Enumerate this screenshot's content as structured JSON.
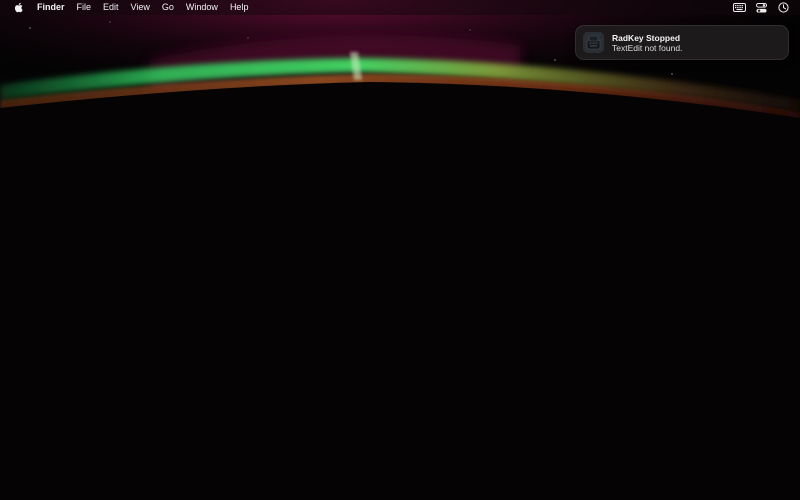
{
  "menubar": {
    "apple_icon": "apple-logo-icon",
    "app_name": "Finder",
    "items": [
      "File",
      "Edit",
      "View",
      "Go",
      "Window",
      "Help"
    ],
    "status_icons": [
      "keyboard-icon",
      "control-center-icon",
      "clock-icon"
    ]
  },
  "notification": {
    "app_icon": "radkey-app-icon",
    "title": "RadKey Stopped",
    "body": "TextEdit not found."
  },
  "colors": {
    "aurora_green": "#2fbf4a",
    "aurora_magenta": "#8a1a4a",
    "aurora_orange": "#b0562a",
    "background": "#040304"
  }
}
